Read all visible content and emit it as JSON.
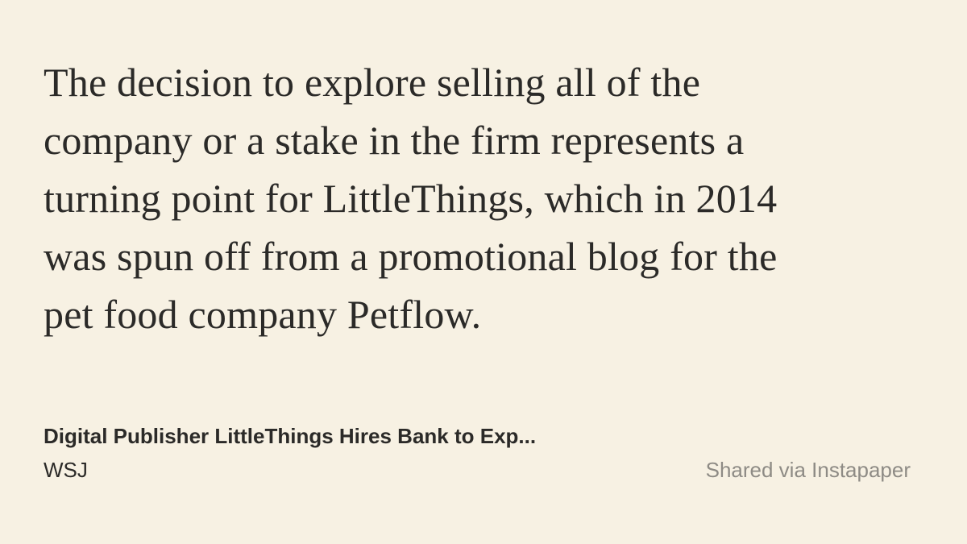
{
  "quote": {
    "lines": [
      "The decision to explore selling all of the",
      "company or a stake in the firm represents a",
      "turning point for LittleThings, which in 2014",
      "was spun off from a promotional blog for the",
      "pet food company Petflow."
    ]
  },
  "article": {
    "title": "Digital Publisher LittleThings Hires Bank to Exp...",
    "source": "WSJ"
  },
  "footer": {
    "shared_via": "Shared via Instapaper"
  },
  "colors": {
    "background": "#f7f1e3",
    "text": "#2b2a28",
    "muted": "#8e8b85"
  }
}
